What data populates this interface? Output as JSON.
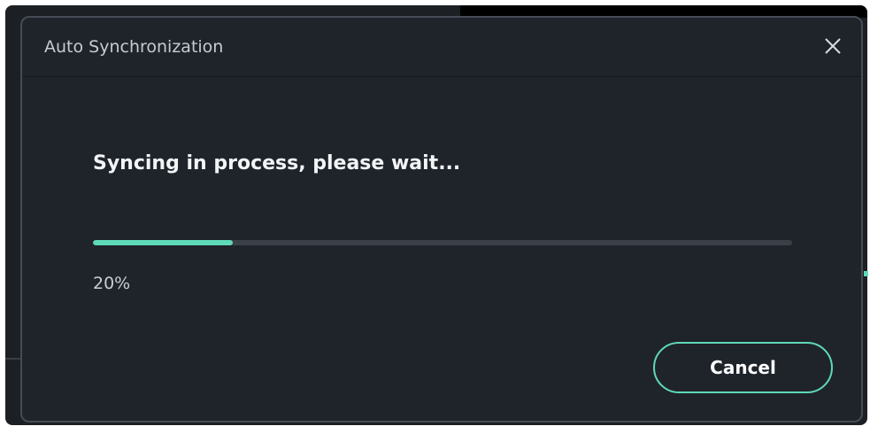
{
  "dialog": {
    "title": "Auto Synchronization",
    "close_icon": "close-icon",
    "message": "Syncing in process, please wait...",
    "progress": {
      "percent_text": "20%",
      "value": 0.2
    },
    "cancel_label": "Cancel"
  },
  "colors": {
    "dialog_background": "#1f242b",
    "accent": "#5fd9b7",
    "track": "#3b4048",
    "text_primary": "#f2f4f6",
    "text_secondary": "#c7cbd1"
  }
}
